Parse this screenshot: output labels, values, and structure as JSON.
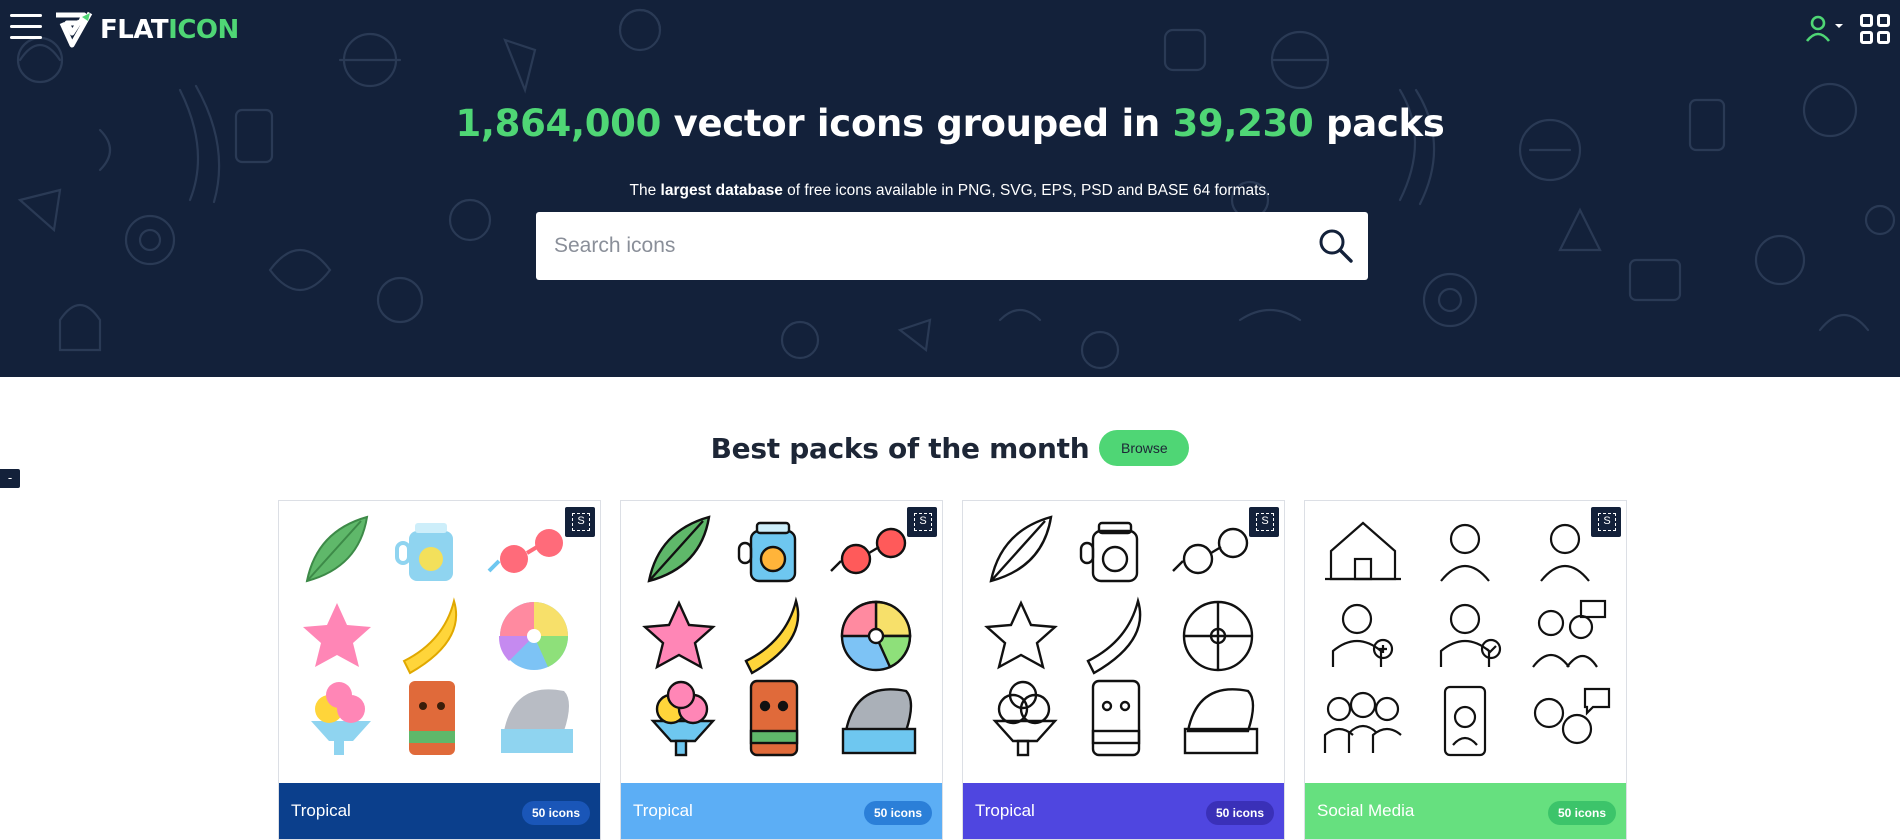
{
  "header": {
    "logo_text_white": "FLAT",
    "logo_text_green": "ICON",
    "menu_icon": "hamburger-icon",
    "user_icon": "user-icon",
    "apps_icon": "grid-icon"
  },
  "hero": {
    "count_icons": "1,864,000",
    "text_middle": " vector icons grouped in ",
    "count_packs": "39,230",
    "text_end": " packs",
    "sub_the": "The ",
    "sub_bold": "largest database",
    "sub_rest": " of free icons available in PNG, SVG, EPS, PSD and BASE 64 formats.",
    "search_placeholder": "Search icons"
  },
  "packs": {
    "title": "Best packs of the month",
    "browse_label": "Browse",
    "side_tab": "-",
    "items": [
      {
        "name": "Tropical",
        "count": "50 icons",
        "style": "flat",
        "footer_color": "#0b3f8c",
        "badge_color": "#1a56b8"
      },
      {
        "name": "Tropical",
        "count": "50 icons",
        "style": "lineal-color",
        "footer_color": "#5caef5",
        "badge_color": "#2b7fd8"
      },
      {
        "name": "Tropical",
        "count": "50 icons",
        "style": "outline",
        "footer_color": "#4f46e0",
        "badge_color": "#3a30b8"
      },
      {
        "name": "Social Media",
        "count": "50 icons",
        "style": "outline",
        "footer_color": "#66e07f",
        "badge_color": "#3cc46a"
      }
    ]
  },
  "colors": {
    "hero_bg": "#13213a",
    "brand_green": "#4fd675"
  }
}
